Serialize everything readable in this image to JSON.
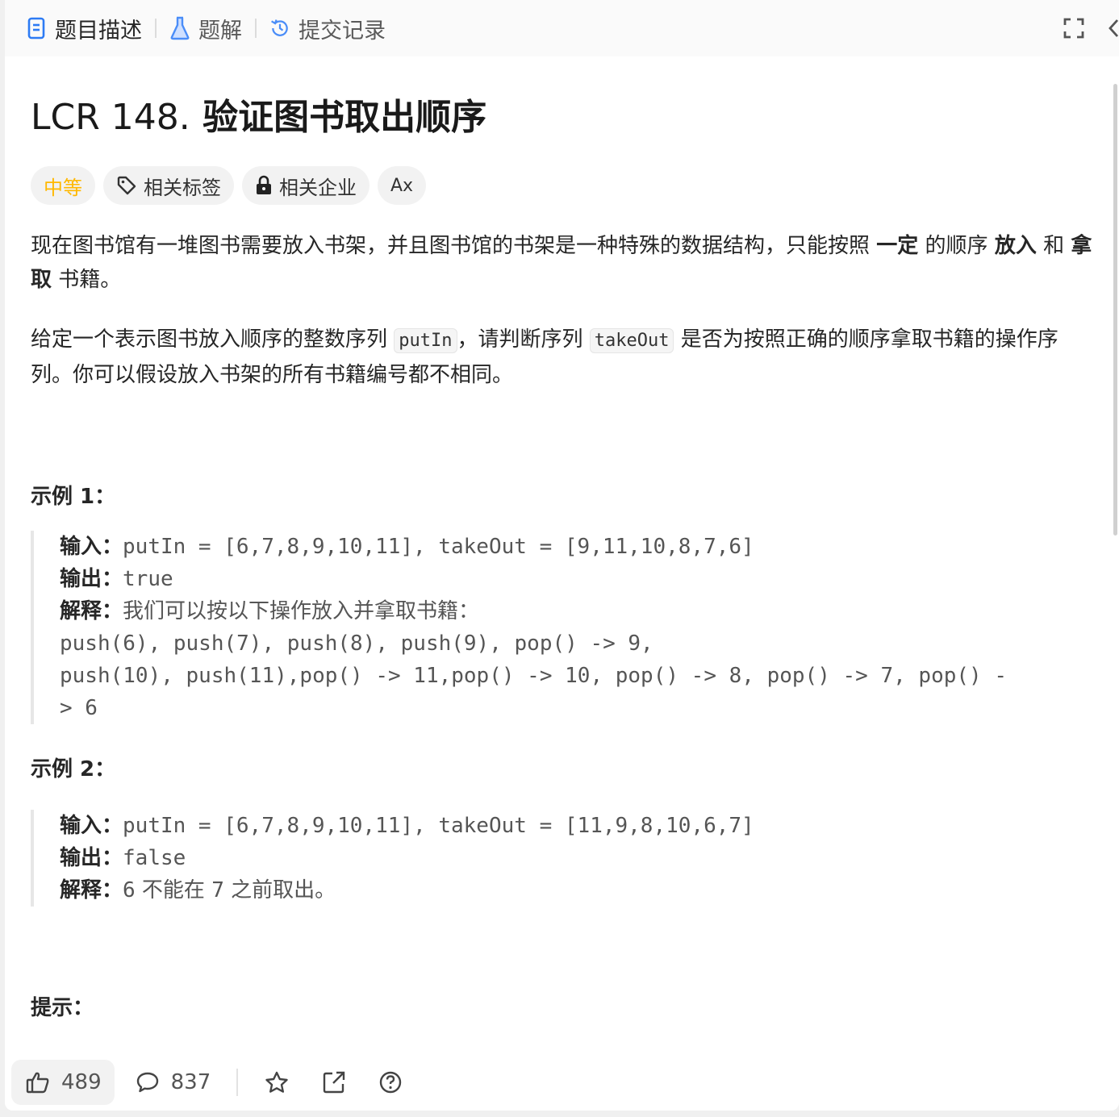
{
  "tabs": [
    {
      "label": "题目描述",
      "icon": "document-icon",
      "active": true
    },
    {
      "label": "题解",
      "icon": "flask-icon",
      "active": false
    },
    {
      "label": "提交记录",
      "icon": "history-icon",
      "active": false
    }
  ],
  "problem": {
    "number": "LCR 148.",
    "name": "验证图书取出顺序",
    "difficulty": "中等",
    "tags": [
      "相关标签",
      "相关企业"
    ],
    "translate_icon": "Ax"
  },
  "description": {
    "p1_a": "现在图书馆有一堆图书需要放入书架，并且图书馆的书架是一种特殊的数据结构，只能按照 ",
    "p1_b1": "一定",
    "p1_c": " 的顺序 ",
    "p1_b2": "放入",
    "p1_d": " 和 ",
    "p1_b3": "拿取",
    "p1_e": " 书籍。",
    "p2_a": "给定一个表示图书放入顺序的整数序列 ",
    "p2_code1": "putIn",
    "p2_b": "，请判断序列 ",
    "p2_code2": "takeOut",
    "p2_c": " 是否为按照正确的顺序拿取书籍的操作序列。你可以假设放入书架的所有书籍编号都不相同。"
  },
  "examples": [
    {
      "title": "示例 1：",
      "input_label": "输入：",
      "input": "putIn = [6,7,8,9,10,11], takeOut = [9,11,10,8,7,6]",
      "output_label": "输出：",
      "output": "true",
      "explain_label": "解释：",
      "explain": "我们可以按以下操作放入并拿取书籍：",
      "extra1": "push(6), push(7), push(8), push(9), pop() -> 9,",
      "extra2": "push(10), push(11),pop() -> 11,pop() -> 10, pop() -> 8, pop() -> 7, pop() -",
      "extra3": "> 6"
    },
    {
      "title": "示例 2：",
      "input_label": "输入：",
      "input": "putIn = [6,7,8,9,10,11], takeOut = [11,9,8,10,6,7]",
      "output_label": "输出：",
      "output": "false",
      "explain_label": "解释：",
      "explain_n1": "6",
      "explain_t1": " 不能在 ",
      "explain_n2": "7",
      "explain_t2": " 之前取出。"
    }
  ],
  "hints_title": "提示：",
  "footer": {
    "likes": "489",
    "comments": "837"
  },
  "colors": {
    "difficulty": "#ffb800",
    "accent": "#2d7bf4"
  }
}
